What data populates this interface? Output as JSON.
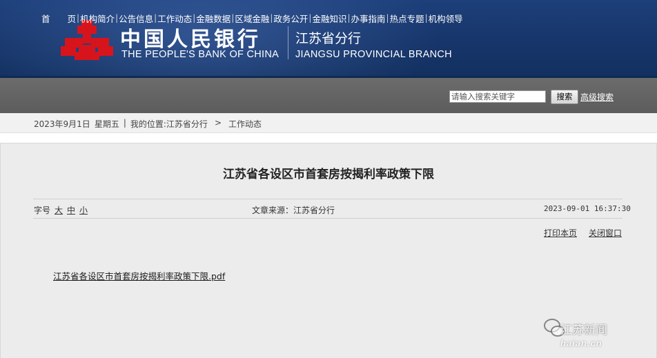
{
  "header": {
    "bank_name_cn": "中国人民银行",
    "bank_name_en": "THE PEOPLE'S BANK OF CHINA",
    "branch_cn": "江苏省分行",
    "branch_en": "JIANGSU PROVINCIAL BRANCH",
    "logo_icon": "pboc-emblem-icon",
    "banner_color": "#1b3b74",
    "logo_color": "#d7141c"
  },
  "nav": {
    "items": [
      "首　　页",
      "机构简介",
      "公告信息",
      "工作动态",
      "金融数据",
      "区域金融",
      "政务公开",
      "金融知识",
      "办事指南",
      "热点专题",
      "机构领导"
    ],
    "search_placeholder": "请输入搜索关键字",
    "search_button": "搜索",
    "advanced_search": "高级搜索"
  },
  "breadcrumb": {
    "date": "2023年9月1日",
    "weekday": "星期五",
    "location_label": "我的位置:",
    "path": [
      "江苏省分行",
      "工作动态"
    ]
  },
  "article": {
    "title": "江苏省各设区市首套房按揭利率政策下限",
    "font_size_label": "字号",
    "font_sizes": [
      "大",
      "中",
      "小"
    ],
    "source": "文章来源：江苏省分行",
    "pub_time": "2023-09-01 16:37:30",
    "print_label": "打印本页",
    "close_label": "关闭窗口",
    "attachment": "江苏省各设区市首套房按揭利率政策下限.pdf"
  },
  "watermark": {
    "text": "江苏新闻",
    "sub": "haian.cn",
    "icon": "wechat-icon"
  }
}
